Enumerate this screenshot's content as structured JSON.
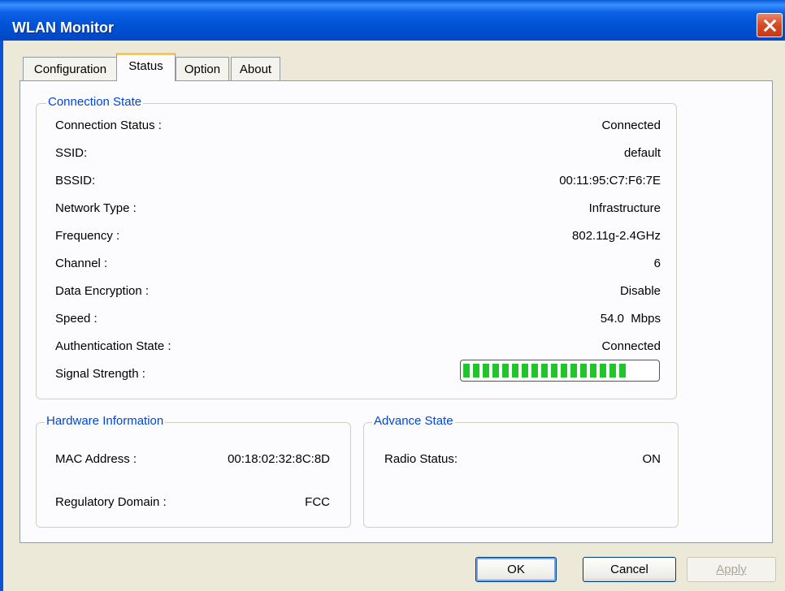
{
  "window": {
    "title": "WLAN Monitor"
  },
  "tabs": [
    {
      "label": "Configuration"
    },
    {
      "label": "Status"
    },
    {
      "label": "Option"
    },
    {
      "label": "About"
    }
  ],
  "connection_state": {
    "legend": "Connection State",
    "rows": [
      {
        "label": "Connection Status :",
        "value": "Connected"
      },
      {
        "label": "SSID:",
        "value": "default"
      },
      {
        "label": "BSSID:",
        "value": "00:11:95:C7:F6:7E"
      },
      {
        "label": "Network Type :",
        "value": "Infrastructure"
      },
      {
        "label": "Frequency :",
        "value": "802.11g-2.4GHz"
      },
      {
        "label": "Channel :",
        "value": "6"
      },
      {
        "label": "Data Encryption :",
        "value": "Disable"
      },
      {
        "label": "Speed :",
        "value": "54.0  Mbps"
      },
      {
        "label": "Authentication State :",
        "value": "Connected"
      }
    ],
    "signal_label": "Signal Strength :",
    "signal_strength": 0.85,
    "signal_color": "#22c42b"
  },
  "hardware_info": {
    "legend": "Hardware Information",
    "rows": [
      {
        "label": "MAC Address :",
        "value": "00:18:02:32:8C:8D"
      },
      {
        "label": "Regulatory Domain :",
        "value": "FCC"
      }
    ]
  },
  "advance_state": {
    "legend": "Advance State",
    "rows": [
      {
        "label": "Radio Status:",
        "value": "ON"
      }
    ]
  },
  "buttons": {
    "ok": "OK",
    "cancel": "Cancel",
    "apply": "Apply"
  },
  "icons": {
    "close": "close-icon"
  },
  "colors": {
    "accent": "#0046d5",
    "titlebar": "#0053d6",
    "active_tab": "#ffc83c"
  }
}
